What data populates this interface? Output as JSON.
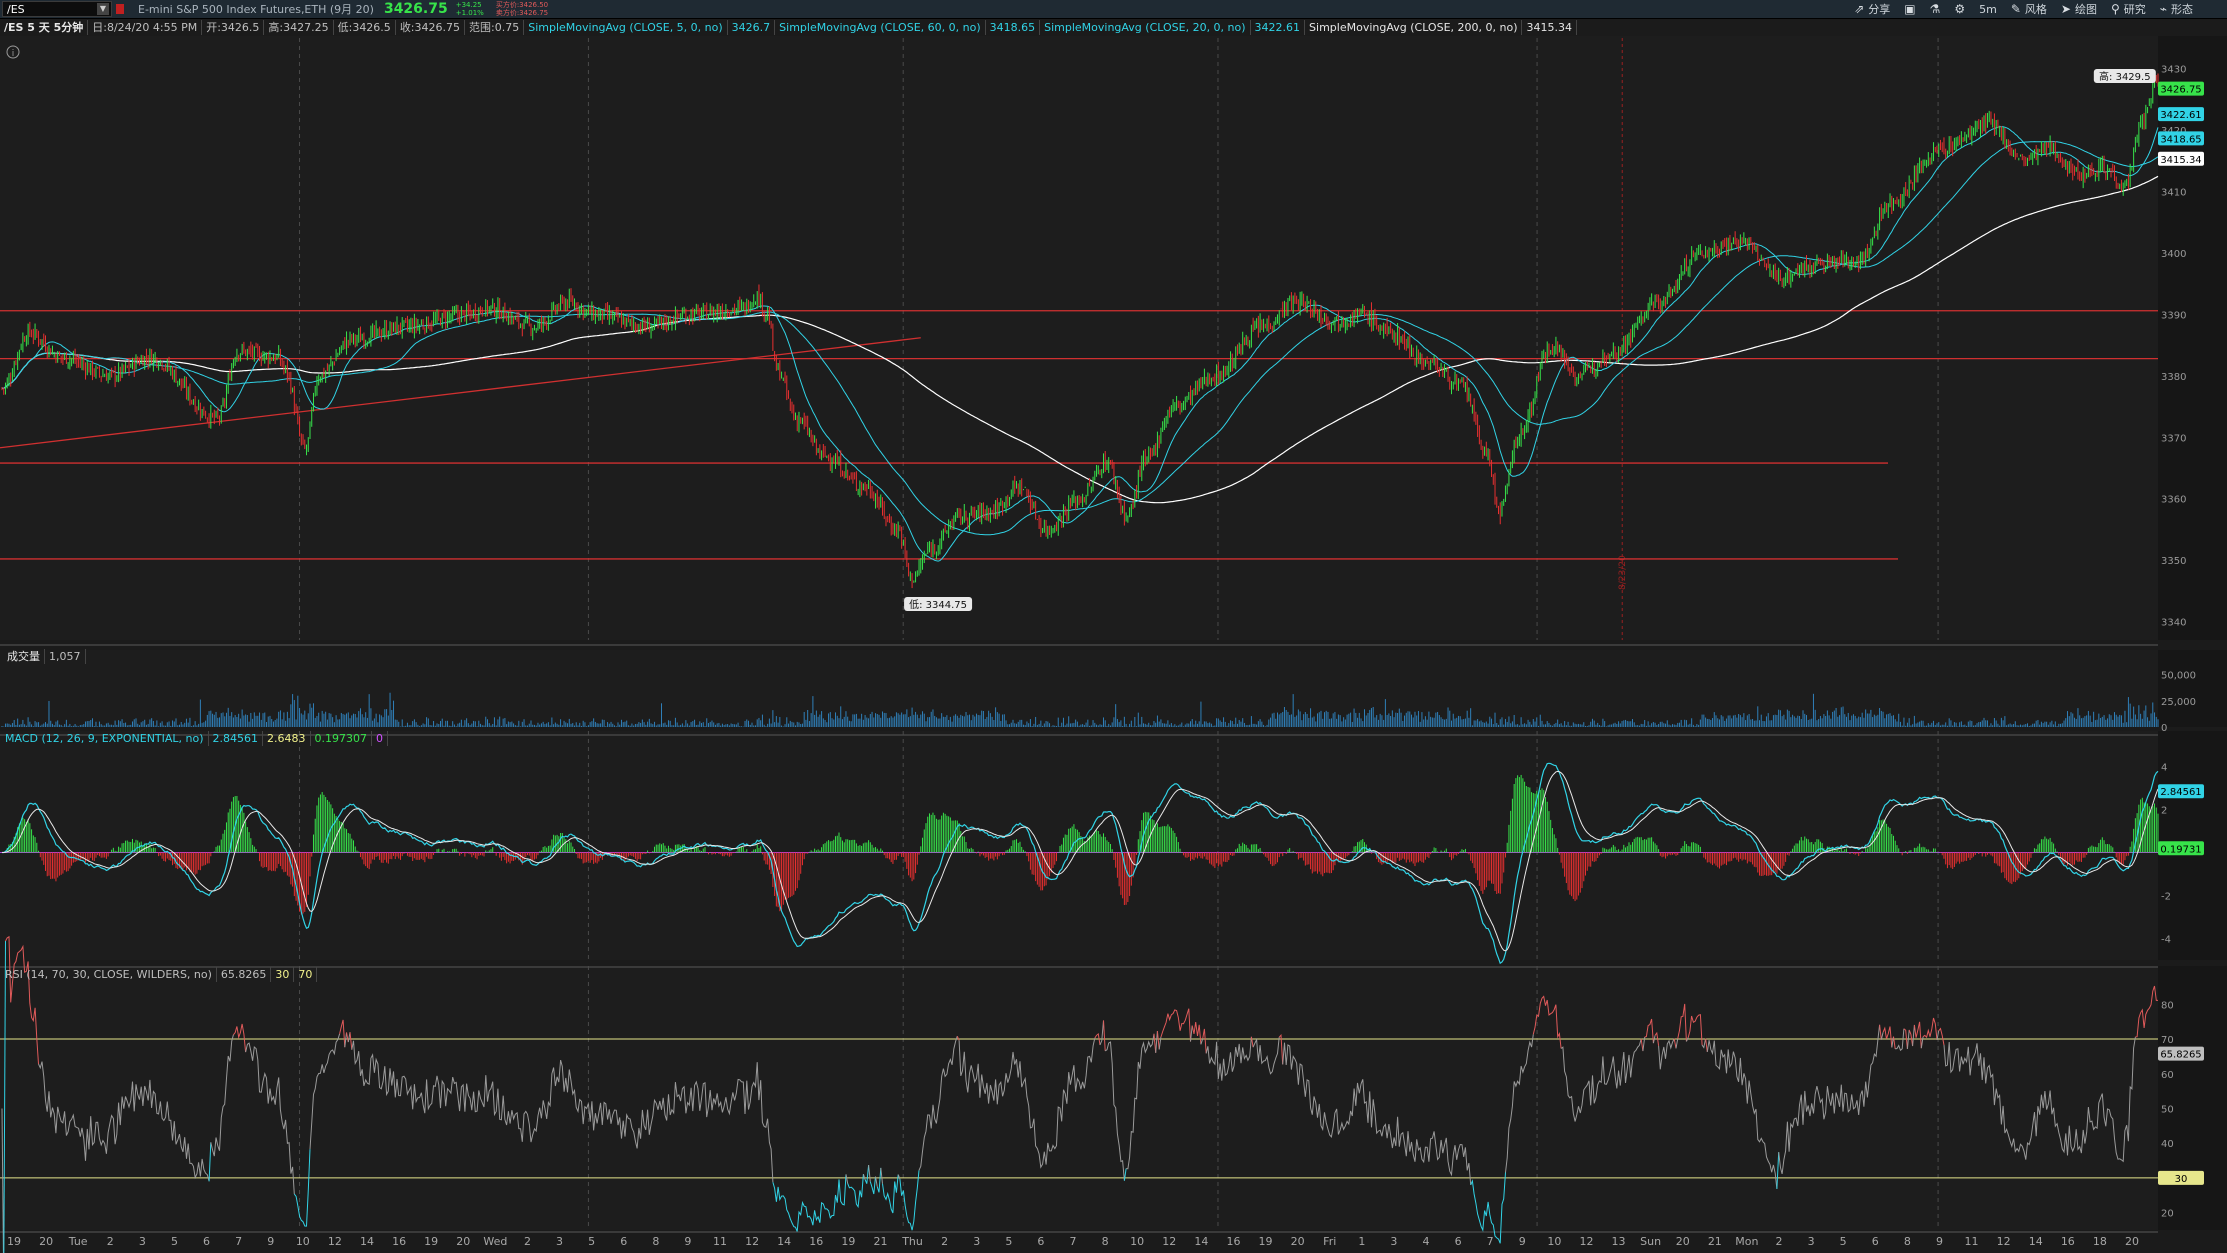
{
  "header": {
    "symbol": "/ES",
    "instrument": "E-mini S&P 500 Index Futures,ETH (9月 20)",
    "last_price": "3426.75",
    "change": "+34.25",
    "change_pct": "+1.01%",
    "bid": "买方价:3426.50",
    "ask": "卖方价:3426.75"
  },
  "toolbar": {
    "share": "分享",
    "timeframe": "5m",
    "style": "风格",
    "drawing": "绘图",
    "studies": "研究",
    "patterns": "形态"
  },
  "infobar": {
    "period": "/ES 5 天 5分钟",
    "date": "日:8/24/20 4:55 PM",
    "open": "开:3426.5",
    "high": "高:3427.25",
    "low": "低:3426.5",
    "close": "收:3426.75",
    "range": "范围:0.75",
    "sma5": "SimpleMovingAvg (CLOSE, 5, 0, no)",
    "sma5_val": "3426.7",
    "sma60": "SimpleMovingAvg (CLOSE, 60, 0, no)",
    "sma60_val": "3418.65",
    "sma20": "SimpleMovingAvg (CLOSE, 20, 0, no)",
    "sma20_val": "3422.61",
    "sma200": "SimpleMovingAvg (CLOSE, 200, 0, no)",
    "sma200_val": "3415.34"
  },
  "price_pane": {
    "y_ticks": [
      "3430",
      "3420",
      "3410",
      "3400",
      "3390",
      "3380",
      "3370",
      "3360",
      "3350",
      "3340"
    ],
    "high_marker": "高: 3429.5",
    "low_marker": "低: 3344.75",
    "bubbles": {
      "last": "3426.75",
      "sma20": "3422.61",
      "sma60": "3418.65",
      "sma200": "3415.34"
    },
    "vline_label": "8/23/20"
  },
  "volume_pane": {
    "title": "成交量",
    "value": "1,057",
    "ticks": [
      "50,000",
      "25,000",
      "0"
    ]
  },
  "macd_pane": {
    "title": "MACD (12, 26, 9, EXPONENTIAL, no)",
    "value": "2.84561",
    "avg": "2.6483",
    "diff": "0.197307",
    "zero": "0",
    "ticks": [
      "4",
      "2",
      "-2",
      "-4"
    ],
    "bubbles": {
      "value": "2.84561",
      "diff": "0.19731"
    }
  },
  "rsi_pane": {
    "title": "RSI (14, 70, 30, CLOSE, WILDERS, no)",
    "value": "65.8265",
    "os": "30",
    "ob": "70",
    "ticks": [
      "80",
      "70",
      "60",
      "50",
      "40",
      "30",
      "20"
    ],
    "bubbles": {
      "value": "65.8265",
      "os": "30"
    }
  },
  "x_axis": {
    "labels": [
      "19",
      "20",
      "Tue",
      "2",
      "3",
      "5",
      "6",
      "7",
      "9",
      "10",
      "12",
      "14",
      "16",
      "19",
      "20",
      "Wed",
      "2",
      "3",
      "5",
      "6",
      "8",
      "9",
      "11",
      "12",
      "14",
      "16",
      "19",
      "21",
      "Thu",
      "2",
      "3",
      "5",
      "6",
      "7",
      "8",
      "10",
      "12",
      "14",
      "16",
      "19",
      "20",
      "Fri",
      "1",
      "3",
      "4",
      "6",
      "7",
      "9",
      "10",
      "12",
      "13",
      "Sun",
      "20",
      "21",
      "Mon",
      "2",
      "3",
      "5",
      "6",
      "8",
      "9",
      "11",
      "12",
      "14",
      "16",
      "18",
      "20"
    ]
  },
  "colors": {
    "up": "#37e34a",
    "down": "#e83030",
    "sma5": "#31d3e6",
    "sma20": "#31d3e6",
    "sma60": "#31d3e6",
    "sma200": "#ffffff",
    "rsi": "#9a9a9a",
    "hline": "#d03030"
  }
}
